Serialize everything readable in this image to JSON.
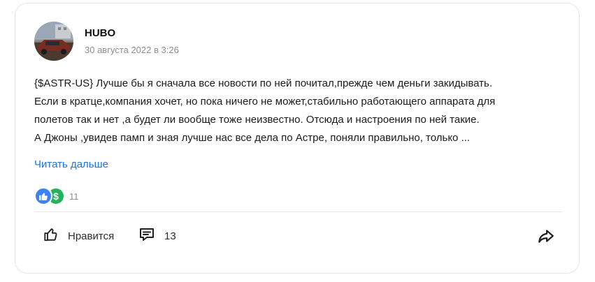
{
  "post": {
    "author": "HUBO",
    "date": "30 августа 2022 в 3:26",
    "lines": [
      "{$ASTR-US} Лучше бы я сначала все новости по ней почитал,прежде чем деньги закидывать.",
      "Если в кратце,компания хочет, но пока ничего не может,стабильно работающего аппарата для",
      "полетов так и нет ,а будет ли вообще тоже неизвестно. Отсюда и настроения по ней такие.",
      "А Джоны ,увидев памп и  зная лучше нас все дела по Астре, поняли правильно, только ..."
    ],
    "read_more": "Читать дальше"
  },
  "reactions": {
    "count": "11",
    "icons": [
      "thumbs-up-icon",
      "dollar-icon"
    ],
    "dollar_symbol": "$"
  },
  "actions": {
    "like_label": "Нравится",
    "comments_count": "13"
  },
  "colors": {
    "link": "#1a73e8",
    "like_reaction": "#3b82f6",
    "dollar_reaction": "#22b45a",
    "meta_text": "#8c8f94"
  }
}
